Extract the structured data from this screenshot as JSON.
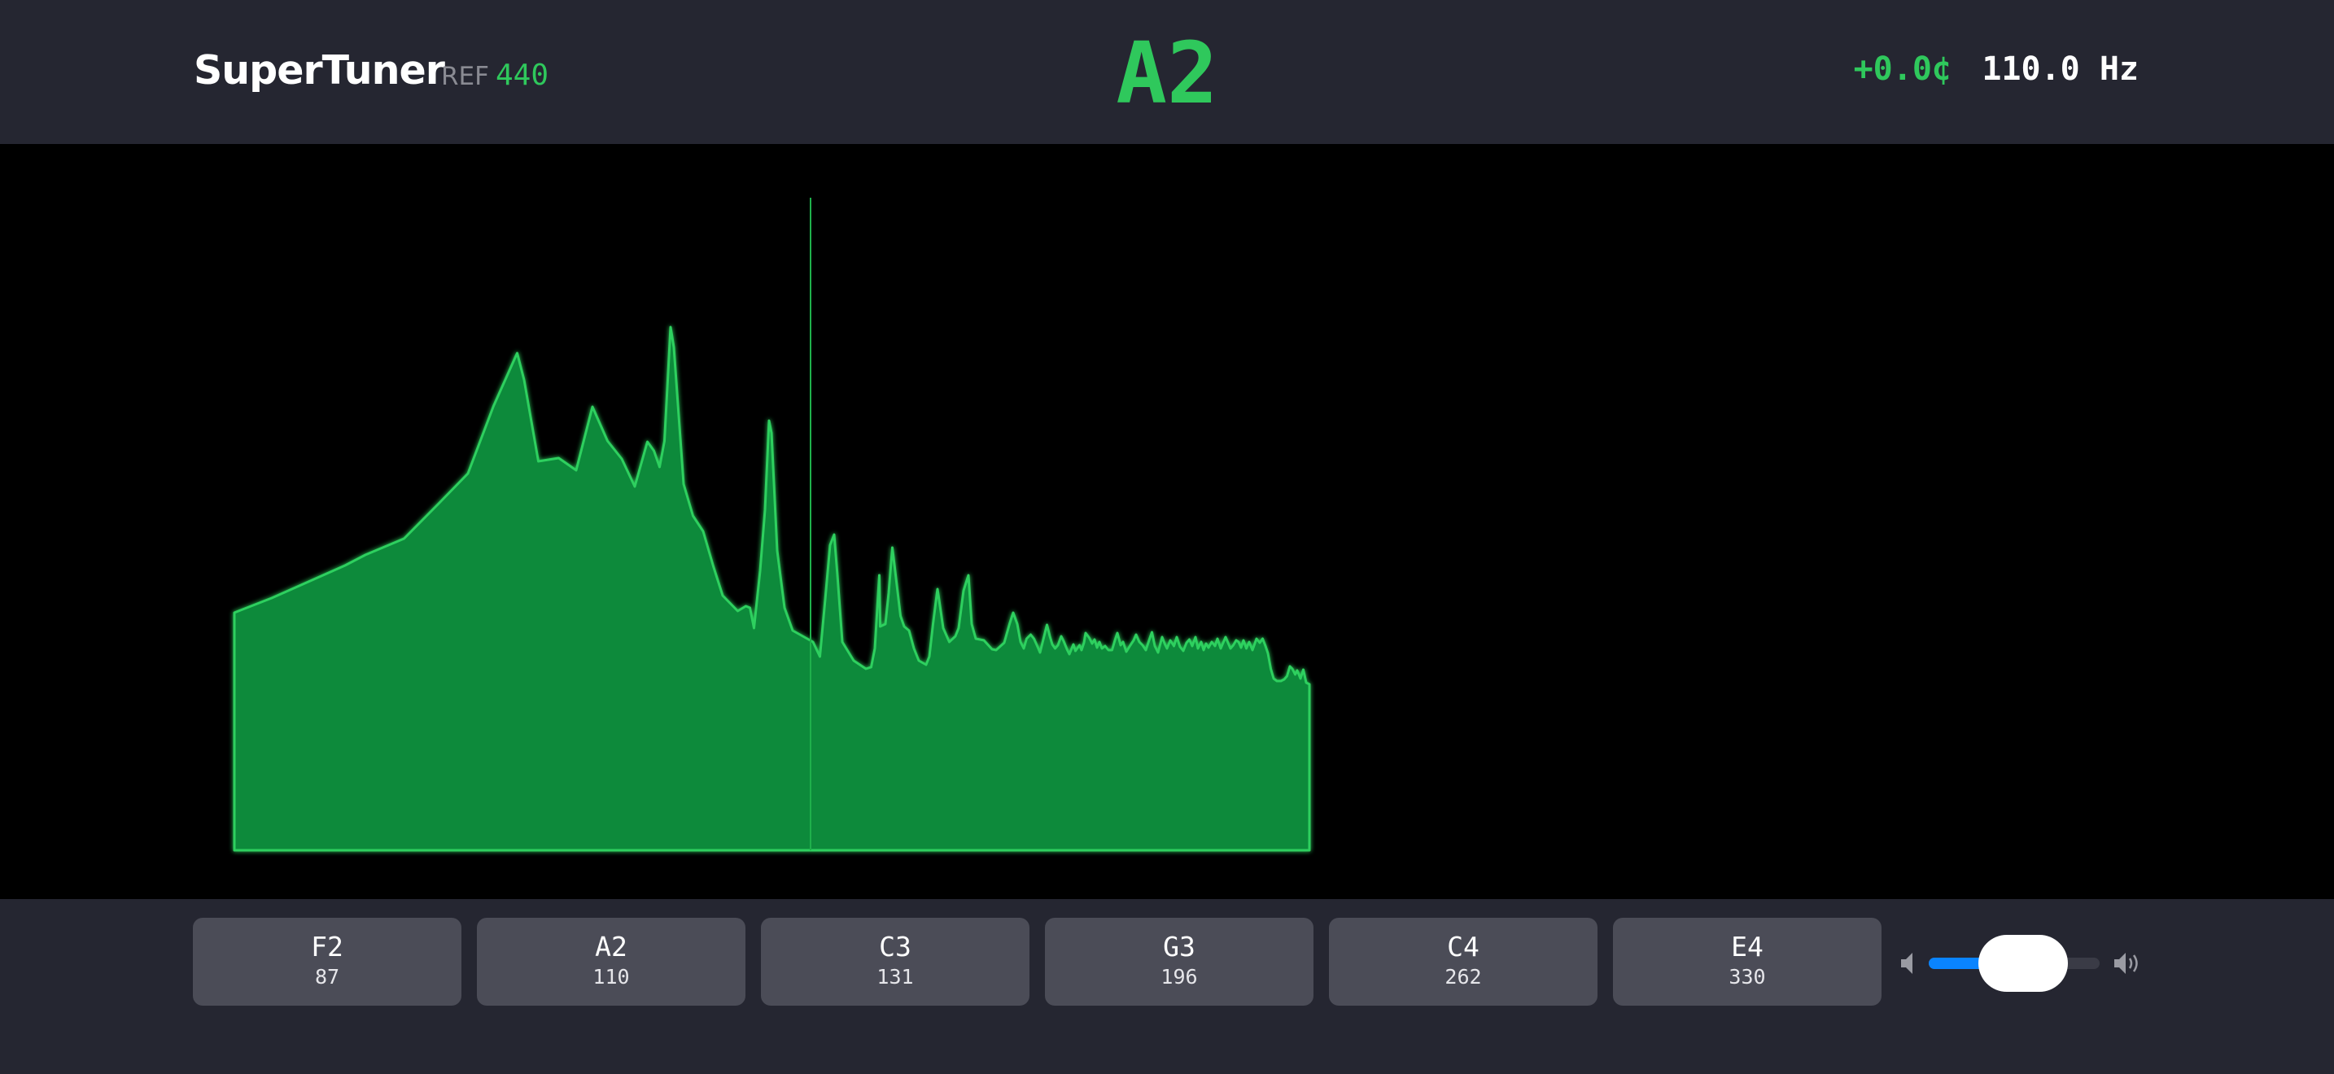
{
  "header": {
    "app_title": "SuperTuner",
    "ref_label": "REF",
    "ref_value": "440",
    "note": "A2",
    "cents": "+0.0¢",
    "frequency": "110.0 Hz"
  },
  "spectrum": {
    "fill_color": "#098a3a",
    "stroke_color": "#2fd05e",
    "marker_color": "#1fb04b",
    "peak_frequency_hz": 110.0
  },
  "strings": [
    {
      "name": "F2",
      "hz": "87"
    },
    {
      "name": "A2",
      "hz": "110"
    },
    {
      "name": "C3",
      "hz": "131"
    },
    {
      "name": "G3",
      "hz": "196"
    },
    {
      "name": "C4",
      "hz": "262"
    },
    {
      "name": "E4",
      "hz": "330"
    }
  ],
  "volume": {
    "level": 0.55,
    "low_icon": "speaker-low-icon",
    "high_icon": "speaker-high-icon",
    "accent": "#0a84ff"
  }
}
